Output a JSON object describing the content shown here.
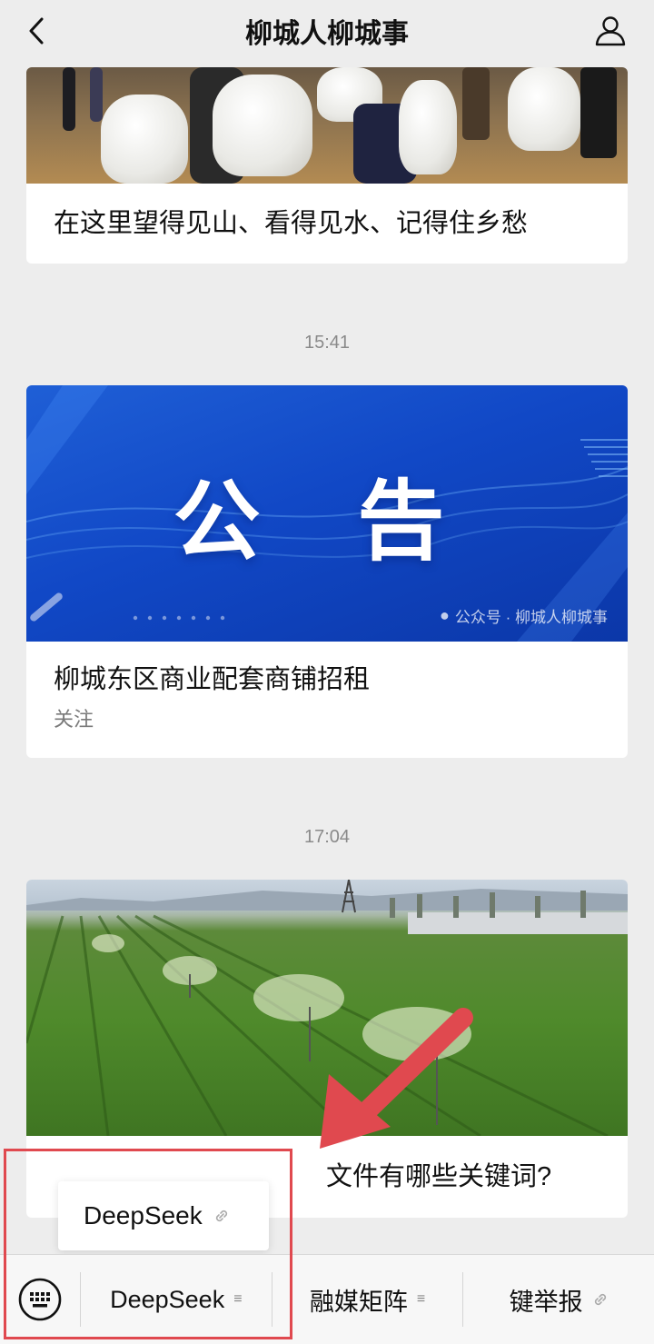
{
  "header": {
    "title": "柳城人柳城事"
  },
  "articles": [
    {
      "headline": "在这里望得见山、看得见水、记得住乡愁"
    },
    {
      "time": "15:41",
      "banner_text": "公 告",
      "banner_watermark": "公众号 · 柳城人柳城事",
      "headline": "柳城东区商业配套商铺招租",
      "sub": "关注"
    },
    {
      "time": "17:04",
      "headline": "文件有哪些关键词?"
    }
  ],
  "popup": {
    "label": "DeepSeek"
  },
  "menu": {
    "items": [
      {
        "label": "DeepSeek"
      },
      {
        "label": "融媒矩阵"
      },
      {
        "label": "键举报"
      }
    ]
  },
  "colors": {
    "highlight": "#e0494f",
    "arrow": "#e0494f",
    "banner_blue": "#1148c6"
  }
}
